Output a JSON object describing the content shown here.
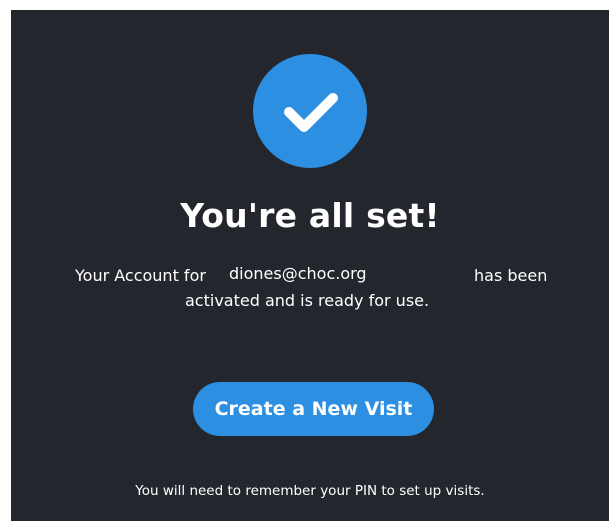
{
  "badge": {
    "icon": "checkmark-icon",
    "color": "#2c8fe2"
  },
  "title": "You're all set!",
  "message": {
    "prefix": "Your Account for",
    "email": "diones@choc.org",
    "suffix": "has been",
    "line2": "activated and is ready for use."
  },
  "cta": {
    "label": "Create a New Visit",
    "color": "#2c8fe2"
  },
  "footnote": "You will need to remember your PIN to set up visits.",
  "theme": {
    "panel_background": "#23272d",
    "text_color": "#ffffff"
  }
}
